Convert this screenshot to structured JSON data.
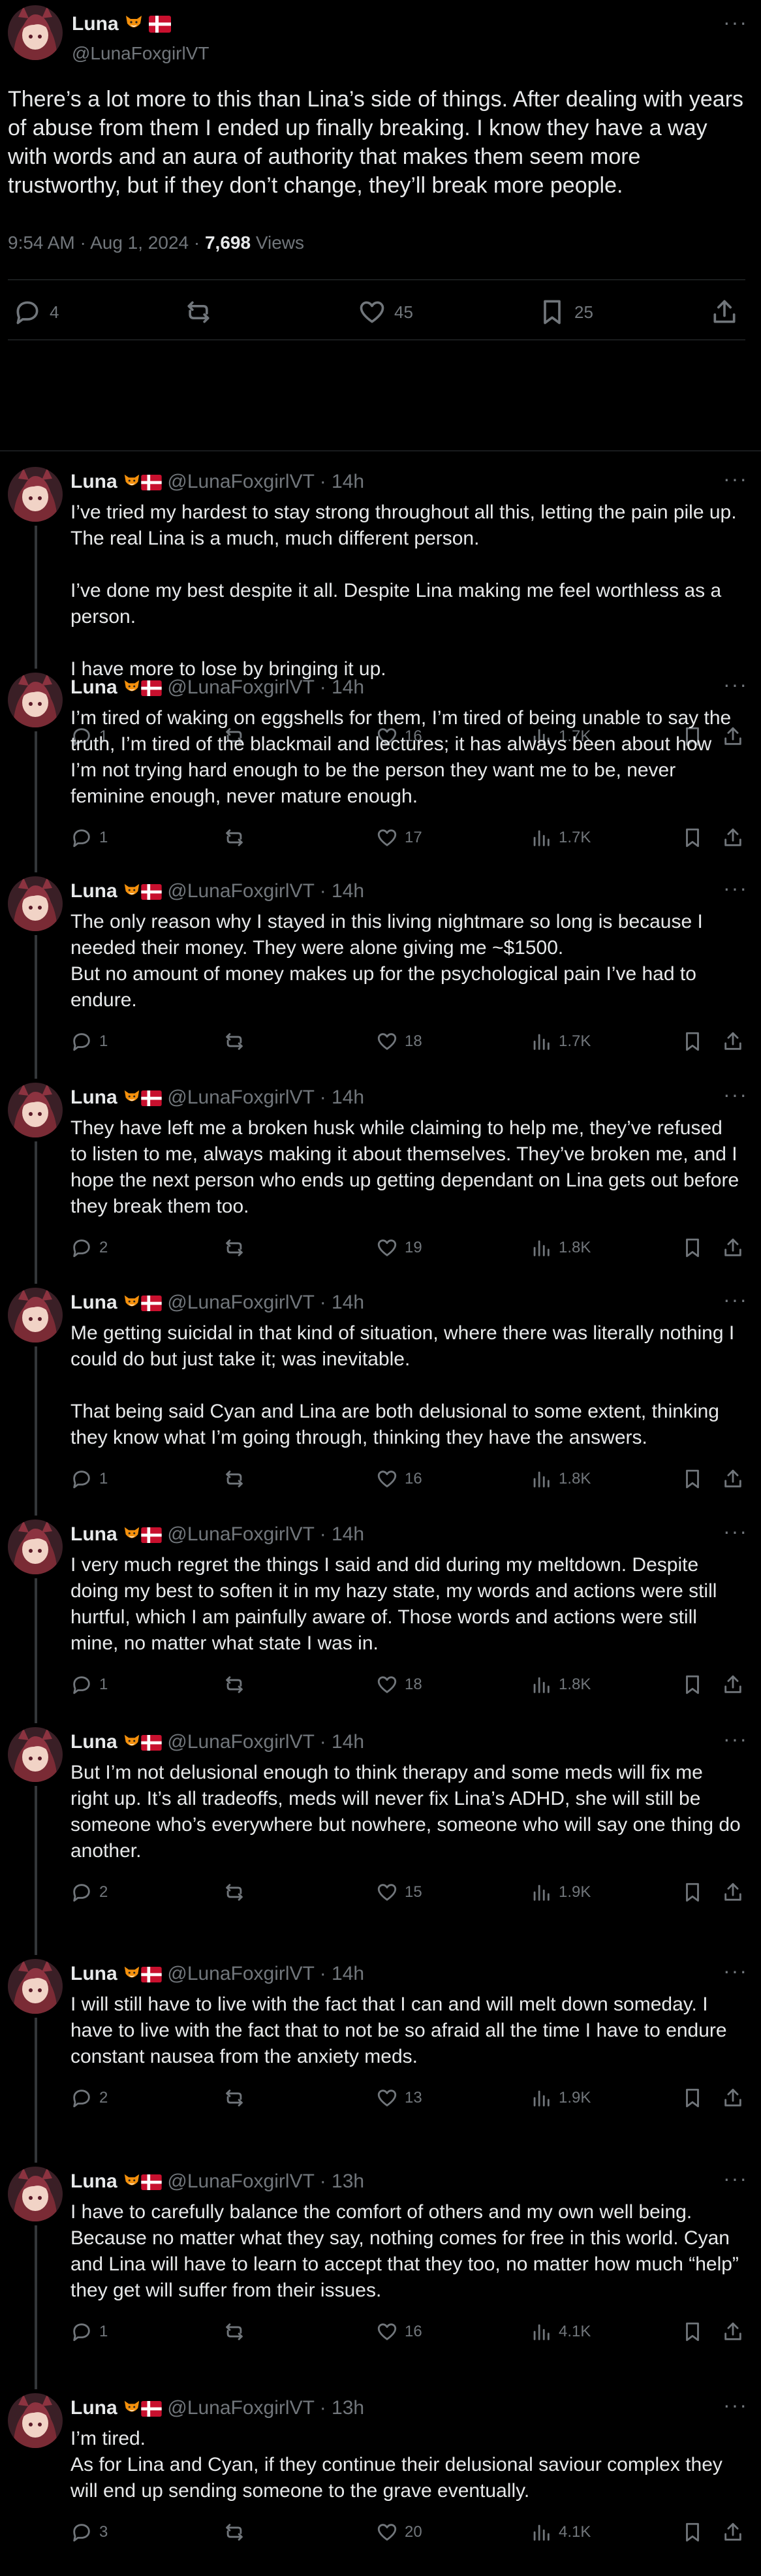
{
  "colors": {
    "background": "#000000",
    "text": "#e7e9ea",
    "muted": "#71767b",
    "divider": "#2f3336"
  },
  "main_tweet": {
    "name": "Luna",
    "handle": "@LunaFoxgirlVT",
    "text": "There’s a lot more to this than Lina’s side of things. After dealing with years of abuse from them I ended up finally breaking. I know they have a way with words and an aura of authority that makes them seem more trustworthy, but if they don’t change, they’ll break more people.",
    "time": "9:54 AM · Aug 1, 2024 · ",
    "views_count": "7,698",
    "views_label": " Views",
    "replies": "4",
    "reposts": "",
    "likes": "45",
    "bookmarks": "25"
  },
  "replies": [
    {
      "name": "Luna",
      "handle": "@LunaFoxgirlVT · 14h",
      "lines": [
        "I’ve tried my hardest to stay strong throughout all this, letting the pain pile up.",
        "The real Lina is a much, much different person.",
        "",
        "I’ve done my best despite it all. Despite Lina making me feel worthless as a person.",
        "",
        "I have more to lose by bringing it up."
      ],
      "replies": "1",
      "likes": "16",
      "views": "1.7K"
    },
    {
      "name": "Luna",
      "handle": "@LunaFoxgirlVT · 14h",
      "lines": [
        "I’m tired of waking on eggshells for them, I’m tired of being unable to say the truth, I’m tired of the blackmail and lectures; it has always been about how I’m not trying hard enough to be the person they want me to be, never feminine enough, never mature enough."
      ],
      "replies": "1",
      "likes": "17",
      "views": "1.7K"
    },
    {
      "name": "Luna",
      "handle": "@LunaFoxgirlVT · 14h",
      "lines": [
        "The only reason why I stayed in this living nightmare so long is because I needed their money. They were alone giving me ~$1500.",
        "But no amount of money makes up for the psychological pain I’ve had to endure."
      ],
      "replies": "1",
      "likes": "18",
      "views": "1.7K"
    },
    {
      "name": "Luna",
      "handle": "@LunaFoxgirlVT · 14h",
      "lines": [
        "They have left me a broken husk while claiming to help me, they’ve refused to listen to me, always making it about themselves. They’ve broken me, and I hope the next person who ends up getting dependant on Lina gets out before they break them too."
      ],
      "replies": "2",
      "likes": "19",
      "views": "1.8K"
    },
    {
      "name": "Luna",
      "handle": "@LunaFoxgirlVT · 14h",
      "lines": [
        "Me getting suicidal in that kind of situation, where there was literally nothing I could do but just take it; was inevitable.",
        "",
        "That being said Cyan and Lina are both delusional to some extent, thinking they know what I’m going through, thinking they have the answers."
      ],
      "replies": "1",
      "likes": "16",
      "views": "1.8K"
    },
    {
      "name": "Luna",
      "handle": "@LunaFoxgirlVT · 14h",
      "lines": [
        "I very much regret the things I said and did during my meltdown. Despite doing my best to soften it in my hazy state, my words and actions were still hurtful, which I am painfully aware of. Those words and actions were still mine, no matter what state I was in."
      ],
      "replies": "1",
      "likes": "18",
      "views": "1.8K"
    },
    {
      "name": "Luna",
      "handle": "@LunaFoxgirlVT · 14h",
      "lines": [
        "But I’m not delusional enough to think therapy and some meds will fix me right up. It’s all tradeoffs, meds will never fix Lina’s ADHD, she will still be someone who’s everywhere but nowhere, someone who will say one thing do another."
      ],
      "replies": "2",
      "likes": "15",
      "views": "1.9K"
    },
    {
      "name": "Luna",
      "handle": "@LunaFoxgirlVT · 14h",
      "lines": [
        "I will still have to live with the fact that I can and will melt down someday. I have to live with the fact that to not be so afraid all the time I have to endure constant nausea from the anxiety meds."
      ],
      "replies": "2",
      "likes": "13",
      "views": "1.9K"
    },
    {
      "name": "Luna",
      "handle": "@LunaFoxgirlVT · 13h",
      "lines": [
        "I have to carefully balance the comfort of others and my own well being. Because no matter what they say, nothing comes for free in this world. Cyan and Lina will have to learn to accept that they too, no matter how much “help” they get will suffer from their issues."
      ],
      "replies": "1",
      "likes": "16",
      "views": "4.1K"
    },
    {
      "name": "Luna",
      "handle": "@LunaFoxgirlVT · 13h",
      "lines": [
        "I’m tired.",
        "As for Lina and Cyan, if they continue their delusional saviour complex they will end up sending someone to the grave eventually."
      ],
      "replies": "3",
      "likes": "20",
      "views": "4.1K"
    }
  ]
}
